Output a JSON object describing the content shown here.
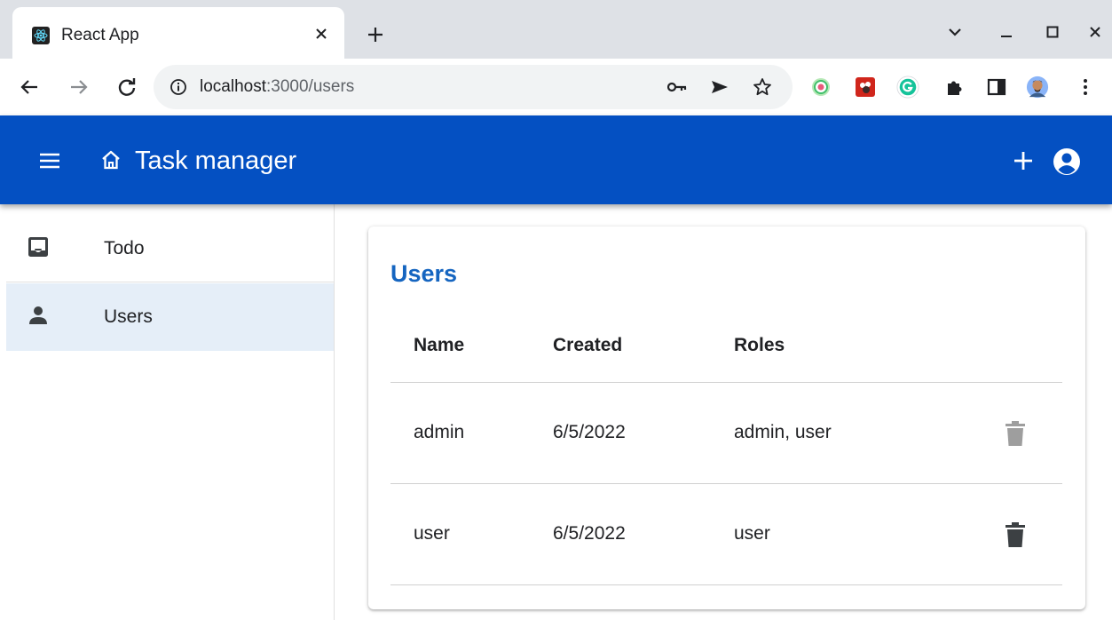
{
  "browser": {
    "tab_title": "React App",
    "tab_favicon": "react-logo-icon",
    "url_host": "localhost",
    "url_path": ":3000/users",
    "toolbar_icons": [
      "back-arrow-icon",
      "forward-arrow-icon",
      "reload-icon",
      "site-info-icon",
      "password-key-icon",
      "send-icon",
      "bookmark-star-icon"
    ],
    "extensions": [
      "target-extension-icon",
      "red-extension-icon",
      "grammarly-icon",
      "puzzle-extensions-icon",
      "side-panel-icon",
      "profile-avatar-icon",
      "kebab-menu-icon"
    ]
  },
  "appbar": {
    "title": "Task manager",
    "color": "#0450c2"
  },
  "drawer": {
    "items": [
      {
        "label": "Todo",
        "icon": "inbox-icon",
        "selected": false
      },
      {
        "label": "Users",
        "icon": "person-icon",
        "selected": true
      }
    ],
    "selected_color": "#e5eef8"
  },
  "users": {
    "title": "Users",
    "title_color": "#1565c0",
    "columns": [
      "Name",
      "Created",
      "Roles"
    ],
    "rows": [
      {
        "name": "admin",
        "created": "6/5/2022",
        "roles": "admin, user",
        "delete_enabled": false
      },
      {
        "name": "user",
        "created": "6/5/2022",
        "roles": "user",
        "delete_enabled": true
      }
    ]
  }
}
